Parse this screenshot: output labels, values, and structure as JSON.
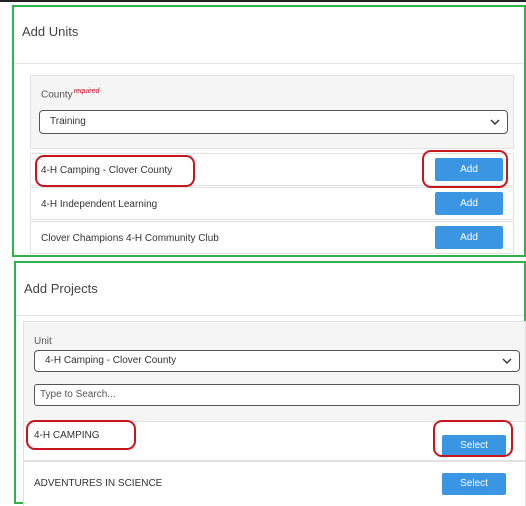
{
  "units_panel": {
    "title": "Add Units",
    "county_label": "County",
    "county_required": "required",
    "county_value": "Training",
    "rows": [
      {
        "label": "4-H Camping - Clover County",
        "button": "Add"
      },
      {
        "label": "4-H Independent Learning",
        "button": "Add"
      },
      {
        "label": "Clover Champions 4-H Community Club",
        "button": "Add"
      }
    ]
  },
  "projects_panel": {
    "title": "Add Projects",
    "unit_label": "Unit",
    "unit_value": "4-H Camping - Clover County",
    "search_placeholder": "Type to Search...",
    "rows": [
      {
        "label": "4-H CAMPING",
        "button": "Select"
      },
      {
        "label": "ADVENTURES IN SCIENCE",
        "button": "Select"
      }
    ]
  },
  "colors": {
    "panel_border": "#2fb24a",
    "button": "#3a95e2",
    "highlight": "#c8161d"
  }
}
